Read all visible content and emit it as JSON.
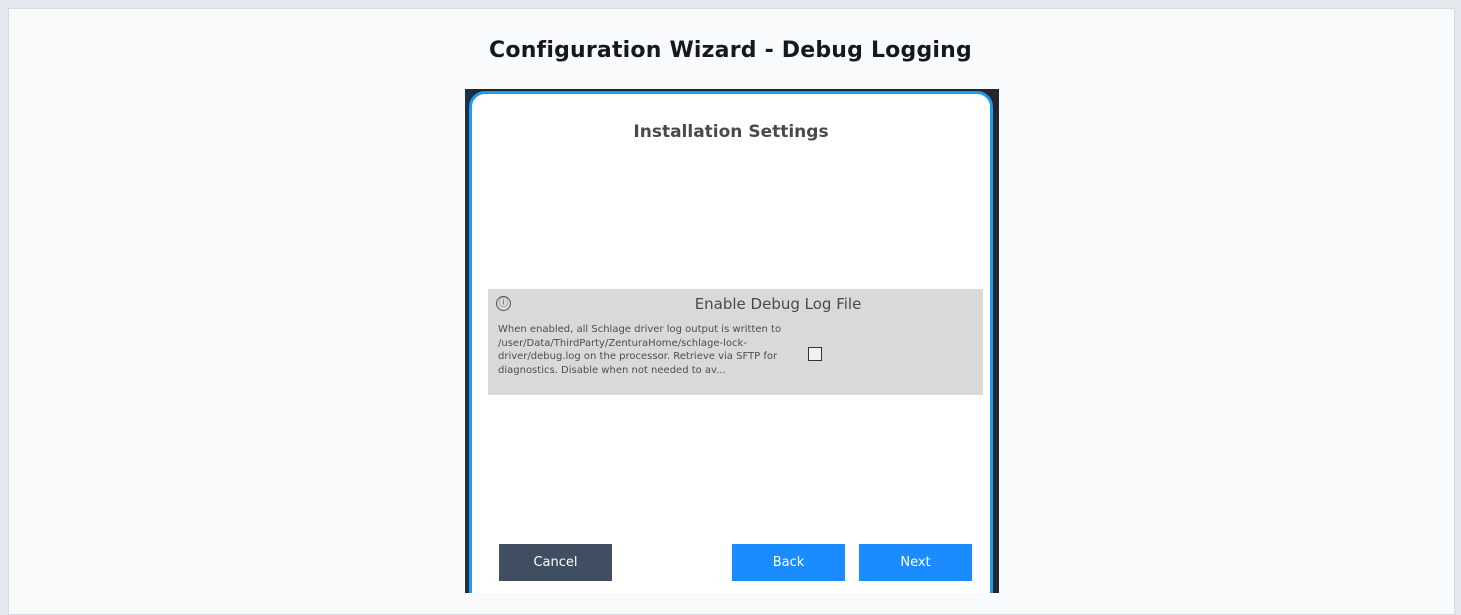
{
  "page": {
    "title": "Configuration Wizard - Debug Logging"
  },
  "dialog": {
    "title": "Installation Settings",
    "accent_color": "#1d9bf0"
  },
  "setting": {
    "info_icon": "ⓘ",
    "label": "Enable Debug Log File",
    "description": "When enabled, all Schlage driver log output is written to /user/Data/ThirdParty/ZenturaHome/schlage-lock-driver/debug.log on the processor. Retrieve via SFTP for diagnostics. Disable when not needed to av...",
    "checked": false
  },
  "buttons": {
    "cancel": "Cancel",
    "back": "Back",
    "next": "Next",
    "cancel_color": "#3f4e61",
    "primary_color": "#1a8cff"
  }
}
